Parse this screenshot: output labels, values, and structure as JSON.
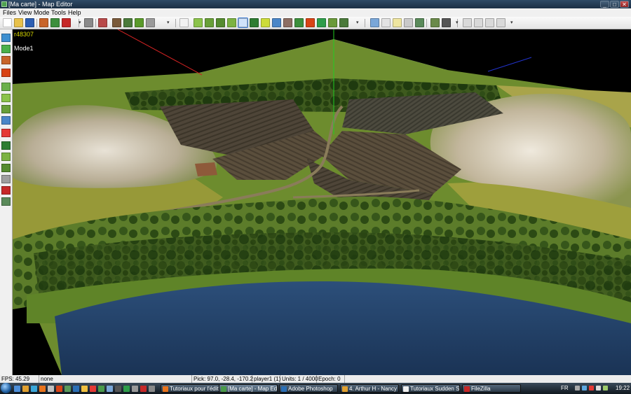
{
  "window": {
    "title": "[Ma carte] - Map Editor",
    "minimize": "_",
    "maximize": "□",
    "close": "✕"
  },
  "menu": [
    "Files",
    "View",
    "Mode",
    "Tools",
    "Help"
  ],
  "toolbar": {
    "buttons": [
      {
        "icon": "new-file-icon",
        "color": "#ffffff"
      },
      {
        "icon": "open-folder-icon",
        "color": "#e8c14a"
      },
      {
        "icon": "save-icon",
        "color": "#2d5fb3"
      },
      {
        "icon": "terrain-icon",
        "color": "#c8642a"
      },
      {
        "icon": "globe-icon",
        "color": "#3d8f3d"
      },
      {
        "icon": "red-tool-icon",
        "color": "#c62828"
      },
      {
        "icon": "undo-icon",
        "color": "#8a8a8a"
      },
      {
        "icon": "terrain-tool-a-icon",
        "color": "#b84a4a"
      },
      {
        "icon": "terrain-tool-b-icon",
        "color": "#7a5a3a"
      },
      {
        "icon": "terrain-tool-c-icon",
        "color": "#4a7a3a"
      },
      {
        "icon": "terrain-tool-d-icon",
        "color": "#5a9a2a"
      },
      {
        "icon": "checker-icon",
        "color": "#9a9a9a"
      },
      {
        "icon": "cursor-icon",
        "color": "#f2f2f2"
      },
      {
        "icon": "brush-a-icon",
        "color": "#8bc34a"
      },
      {
        "icon": "brush-b-icon",
        "color": "#689f38"
      },
      {
        "icon": "brush-c-icon",
        "color": "#558b2f"
      },
      {
        "icon": "brush-d-icon",
        "color": "#7cb342"
      },
      {
        "icon": "brush-e-icon",
        "color": "#4caf50"
      },
      {
        "icon": "brush-f-icon",
        "color": "#2e7d32"
      },
      {
        "icon": "brush-g-icon",
        "color": "#cddc39"
      },
      {
        "icon": "brush-h-icon",
        "color": "#4a86c8"
      },
      {
        "icon": "brush-i-icon",
        "color": "#8d6e63"
      },
      {
        "icon": "brush-j-icon",
        "color": "#3c8f3c"
      },
      {
        "icon": "brush-k-icon",
        "color": "#d84315"
      },
      {
        "icon": "brush-l-icon",
        "color": "#2e9d4a"
      },
      {
        "icon": "brush-m-icon",
        "color": "#6a9a3a"
      },
      {
        "icon": "brush-n-icon",
        "color": "#4a7a3a"
      },
      {
        "icon": "window-a-icon",
        "color": "#7aa7d8"
      },
      {
        "icon": "window-b-icon",
        "color": "#e3e3e3"
      },
      {
        "icon": "window-c-icon",
        "color": "#efe6a0"
      },
      {
        "icon": "window-d-icon",
        "color": "#c9c9c9"
      },
      {
        "icon": "window-e-icon",
        "color": "#5a8a5a"
      },
      {
        "icon": "map-icon",
        "color": "#6a8a4a"
      },
      {
        "icon": "tools-icon",
        "color": "#555555"
      },
      {
        "icon": "disabled-a-icon",
        "color": "#d9d9d9"
      },
      {
        "icon": "disabled-b-icon",
        "color": "#d9d9d9"
      },
      {
        "icon": "disabled-c-icon",
        "color": "#d9d9d9"
      },
      {
        "icon": "disabled-d-icon",
        "color": "#d9d9d9"
      }
    ],
    "active_index": 17
  },
  "sidebar": {
    "buttons": [
      {
        "icon": "layer-terrain-icon",
        "color": "#3d8fd0"
      },
      {
        "icon": "layer-objects-icon",
        "color": "#4ab04a"
      },
      {
        "icon": "layer-buildings-icon",
        "color": "#c8642a"
      },
      {
        "icon": "layer-special-icon",
        "color": "#d84315"
      },
      {
        "icon": "grid-icon",
        "color": "#6ab04a"
      },
      {
        "icon": "paint-a-icon",
        "color": "#8bc34a"
      },
      {
        "icon": "paint-b-icon",
        "color": "#689f38"
      },
      {
        "icon": "paint-c-icon",
        "color": "#4a86c8"
      },
      {
        "icon": "paint-d-icon",
        "color": "#e53935"
      },
      {
        "icon": "paint-e-icon",
        "color": "#2e7d32"
      },
      {
        "icon": "paint-f-icon",
        "color": "#7cb342"
      },
      {
        "icon": "paint-g-icon",
        "color": "#558b2f"
      },
      {
        "icon": "paint-h-icon",
        "color": "#9e9e9e"
      },
      {
        "icon": "paint-i-icon",
        "color": "#c62828"
      },
      {
        "icon": "paint-j-icon",
        "color": "#5a8a5a"
      }
    ]
  },
  "viewport": {
    "id_text": "r48307",
    "mode_text": "Mode1",
    "overlay_color": "#d8d800"
  },
  "status": {
    "fps": "FPS: 45.29",
    "selection": "none",
    "pick": "Pick: 97.0, -28.4, -170.2",
    "player": "player1 (1)",
    "units": "Units: 1 / 4000",
    "epoch": "Epoch: 0"
  },
  "taskbar": {
    "tasks": [
      {
        "label": "Tutoriaux pour l'édit...",
        "color": "#e8731c"
      },
      {
        "label": "[Ma carte] - Map Ed...",
        "color": "#4a9a4a"
      },
      {
        "label": "Adobe Photoshop",
        "color": "#2b6fb5"
      },
      {
        "label": "4. Arthur H - Nancy ...",
        "color": "#e0a030"
      },
      {
        "label": "Tutoriaux Sudden St...",
        "color": "#f0f0f0"
      },
      {
        "label": "FileZilla",
        "color": "#c62828"
      }
    ],
    "active_index": 1,
    "language": "FR",
    "clock": "19:22"
  }
}
